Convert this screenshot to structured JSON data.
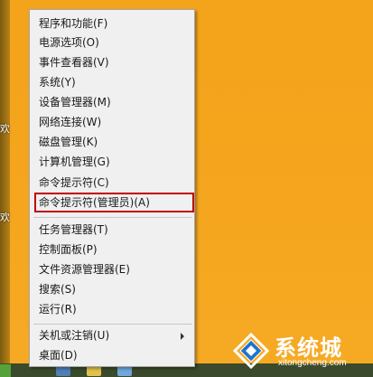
{
  "menu": {
    "groups": [
      [
        {
          "label": "程序和功能(F)"
        },
        {
          "label": "电源选项(O)"
        },
        {
          "label": "事件查看器(V)"
        },
        {
          "label": "系统(Y)"
        },
        {
          "label": "设备管理器(M)"
        },
        {
          "label": "网络连接(W)"
        },
        {
          "label": "磁盘管理(K)"
        },
        {
          "label": "计算机管理(G)"
        },
        {
          "label": "命令提示符(C)"
        },
        {
          "label": "命令提示符(管理员)(A)"
        }
      ],
      [
        {
          "label": "任务管理器(T)"
        },
        {
          "label": "控制面板(P)"
        },
        {
          "label": "文件资源管理器(E)"
        },
        {
          "label": "搜索(S)"
        },
        {
          "label": "运行(R)"
        }
      ],
      [
        {
          "label": "关机或注销(U)",
          "has_submenu": true
        },
        {
          "label": "桌面(D)"
        }
      ]
    ],
    "highlighted_item": "命令提示符(管理员)(A)"
  },
  "watermark": {
    "title": "系统城",
    "url": "xitongcheng.com"
  },
  "colors": {
    "desktop_bg": "#f5a51d",
    "menu_bg": "#f0f0f0",
    "highlight_border": "#c00000",
    "watermark_blue": "#1e73c8"
  }
}
